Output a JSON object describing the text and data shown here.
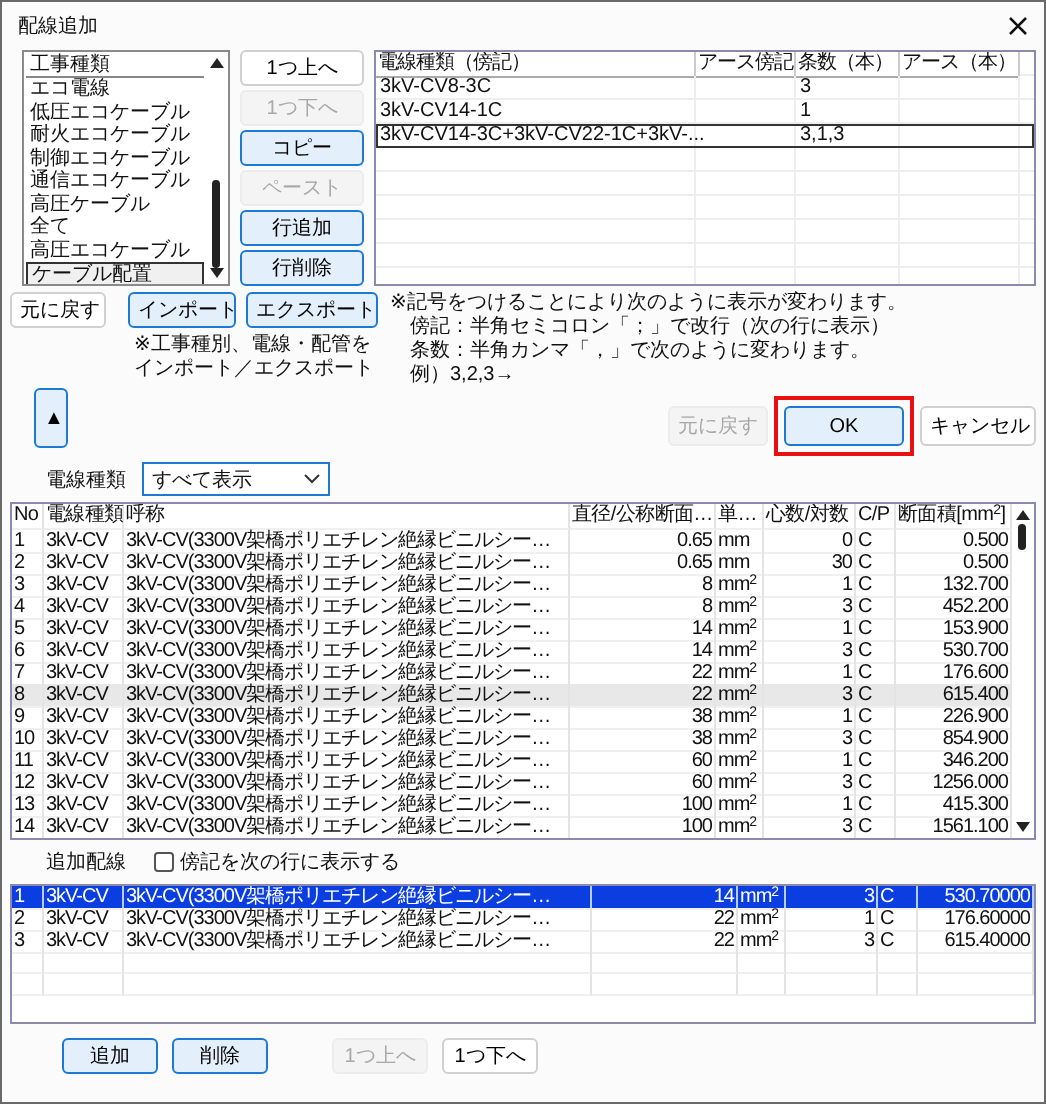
{
  "window": {
    "title": "配線追加"
  },
  "work_types": {
    "heading": "工事種類",
    "items": [
      {
        "label": "エコ電線",
        "selected": false
      },
      {
        "label": "低圧エコケーブル",
        "selected": false
      },
      {
        "label": "耐火エコケーブル",
        "selected": false
      },
      {
        "label": "制御エコケーブル",
        "selected": false
      },
      {
        "label": "通信エコケーブル",
        "selected": false
      },
      {
        "label": "高圧ケーブル",
        "selected": false
      },
      {
        "label": "全て",
        "selected": false
      },
      {
        "label": "高圧エコケーブル",
        "selected": false
      },
      {
        "label": "ケーブル配置",
        "selected": true
      }
    ]
  },
  "row_buttons": [
    {
      "label": "1つ上へ",
      "kind": "plain",
      "disabled": false
    },
    {
      "label": "1つ下へ",
      "kind": "plain",
      "disabled": true
    },
    {
      "label": "コピー",
      "kind": "accent",
      "disabled": false
    },
    {
      "label": "ペースト",
      "kind": "plain",
      "disabled": true
    },
    {
      "label": "行追加",
      "kind": "accent",
      "disabled": false
    },
    {
      "label": "行削除",
      "kind": "accent",
      "disabled": false
    }
  ],
  "wiring_table": {
    "columns": [
      "電線種類（傍記）",
      "アース傍記",
      "条数（本）",
      "アース（本）"
    ],
    "rows": [
      {
        "wire": "3kV-CV8-3C",
        "count": "3",
        "selected": false
      },
      {
        "wire": "3kV-CV14-1C",
        "count": "1",
        "selected": false
      },
      {
        "wire": "3kV-CV14-3C+3kV-CV22-1C+3kV-...",
        "count": "3,1,3",
        "selected": true
      }
    ]
  },
  "undo_button": {
    "label": "元に戻す",
    "kind": "plain",
    "disabled": false
  },
  "transfer_buttons": [
    {
      "label": "インポート",
      "kind": "accent",
      "disabled": false
    },
    {
      "label": "エクスポート",
      "kind": "accent",
      "disabled": false
    }
  ],
  "transfer_note": [
    "※工事種別、電線・配管を",
    "インポート／エクスポート"
  ],
  "collapse_button": {
    "label": "▲"
  },
  "notes": [
    "※記号をつけることにより次のように表示が変わります。",
    "傍記：半角セミコロン「；」で改行（次の行に表示）",
    "条数：半角カンマ「，」で次のように変わります。",
    "例）3,2,3→"
  ],
  "dialog_buttons": [
    {
      "label": "元に戻す",
      "kind": "plain",
      "disabled": true,
      "highlighted": false
    },
    {
      "label": "OK",
      "kind": "accent",
      "disabled": false,
      "highlighted": true
    },
    {
      "label": "キャンセル",
      "kind": "plain",
      "disabled": false,
      "highlighted": false
    }
  ],
  "filter": {
    "label": "電線種類",
    "value": "すべて表示"
  },
  "cable_table": {
    "columns": [
      "No",
      "電線種類",
      "呼称",
      "直径/公称断面…",
      "単…",
      "心数/対数",
      "C/P",
      "断面積[mm$^{2}$]"
    ],
    "rows": [
      {
        "cells": [
          "1",
          "3kV-CV",
          "3kV-CV(3300V架橋ポリエチレン絶縁ビニルシー…",
          "0.65",
          "mm",
          "0",
          "C",
          "0.500"
        ],
        "selected": false
      },
      {
        "cells": [
          "2",
          "3kV-CV",
          "3kV-CV(3300V架橋ポリエチレン絶縁ビニルシー…",
          "0.65",
          "mm",
          "30",
          "C",
          "0.500"
        ],
        "selected": false
      },
      {
        "cells": [
          "3",
          "3kV-CV",
          "3kV-CV(3300V架橋ポリエチレン絶縁ビニルシー…",
          "8",
          "mm$^{2}$",
          "1",
          "C",
          "132.700"
        ],
        "selected": false
      },
      {
        "cells": [
          "4",
          "3kV-CV",
          "3kV-CV(3300V架橋ポリエチレン絶縁ビニルシー…",
          "8",
          "mm$^{2}$",
          "3",
          "C",
          "452.200"
        ],
        "selected": false
      },
      {
        "cells": [
          "5",
          "3kV-CV",
          "3kV-CV(3300V架橋ポリエチレン絶縁ビニルシー…",
          "14",
          "mm$^{2}$",
          "1",
          "C",
          "153.900"
        ],
        "selected": false
      },
      {
        "cells": [
          "6",
          "3kV-CV",
          "3kV-CV(3300V架橋ポリエチレン絶縁ビニルシー…",
          "14",
          "mm$^{2}$",
          "3",
          "C",
          "530.700"
        ],
        "selected": false
      },
      {
        "cells": [
          "7",
          "3kV-CV",
          "3kV-CV(3300V架橋ポリエチレン絶縁ビニルシー…",
          "22",
          "mm$^{2}$",
          "1",
          "C",
          "176.600"
        ],
        "selected": false
      },
      {
        "cells": [
          "8",
          "3kV-CV",
          "3kV-CV(3300V架橋ポリエチレン絶縁ビニルシー…",
          "22",
          "mm$^{2}$",
          "3",
          "C",
          "615.400"
        ],
        "selected": true
      },
      {
        "cells": [
          "9",
          "3kV-CV",
          "3kV-CV(3300V架橋ポリエチレン絶縁ビニルシー…",
          "38",
          "mm$^{2}$",
          "1",
          "C",
          "226.900"
        ],
        "selected": false
      },
      {
        "cells": [
          "10",
          "3kV-CV",
          "3kV-CV(3300V架橋ポリエチレン絶縁ビニルシー…",
          "38",
          "mm$^{2}$",
          "3",
          "C",
          "854.900"
        ],
        "selected": false
      },
      {
        "cells": [
          "11",
          "3kV-CV",
          "3kV-CV(3300V架橋ポリエチレン絶縁ビニルシー…",
          "60",
          "mm$^{2}$",
          "1",
          "C",
          "346.200"
        ],
        "selected": false
      },
      {
        "cells": [
          "12",
          "3kV-CV",
          "3kV-CV(3300V架橋ポリエチレン絶縁ビニルシー…",
          "60",
          "mm$^{2}$",
          "3",
          "C",
          "1256.000"
        ],
        "selected": false
      },
      {
        "cells": [
          "13",
          "3kV-CV",
          "3kV-CV(3300V架橋ポリエチレン絶縁ビニルシー…",
          "100",
          "mm$^{2}$",
          "1",
          "C",
          "415.300"
        ],
        "selected": false
      },
      {
        "cells": [
          "14",
          "3kV-CV",
          "3kV-CV(3300V架橋ポリエチレン絶縁ビニルシー…",
          "100",
          "mm$^{2}$",
          "3",
          "C",
          "1561.100"
        ],
        "selected": false
      }
    ]
  },
  "added": {
    "label": "追加配線",
    "checkbox": {
      "label": "傍記を次の行に表示する",
      "checked": false
    },
    "rows": [
      {
        "cells": [
          "1",
          "3kV-CV",
          "3kV-CV(3300V架橋ポリエチレン絶縁ビニルシー…",
          "14",
          "mm$^{2}$",
          "3",
          "C",
          "530.70000"
        ],
        "selected": true
      },
      {
        "cells": [
          "2",
          "3kV-CV",
          "3kV-CV(3300V架橋ポリエチレン絶縁ビニルシー…",
          "22",
          "mm$^{2}$",
          "1",
          "C",
          "176.60000"
        ],
        "selected": false
      },
      {
        "cells": [
          "3",
          "3kV-CV",
          "3kV-CV(3300V架橋ポリエチレン絶縁ビニルシー…",
          "22",
          "mm$^{2}$",
          "3",
          "C",
          "615.40000"
        ],
        "selected": false
      }
    ]
  },
  "bottom_buttons": [
    {
      "label": "追加",
      "kind": "accent",
      "disabled": false
    },
    {
      "label": "削除",
      "kind": "accent",
      "disabled": false
    },
    {
      "label": "1つ上へ",
      "kind": "plain",
      "disabled": true
    },
    {
      "label": "1つ下へ",
      "kind": "plain",
      "disabled": false
    }
  ]
}
